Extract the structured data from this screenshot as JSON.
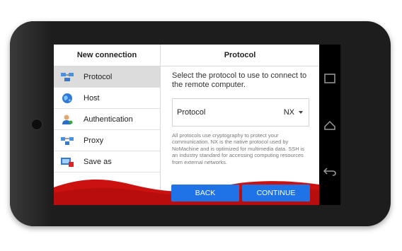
{
  "sidebar": {
    "title": "New connection",
    "items": [
      {
        "label": "Protocol",
        "icon": "network-icon",
        "active": true
      },
      {
        "label": "Host",
        "icon": "globe-icon",
        "active": false
      },
      {
        "label": "Authentication",
        "icon": "user-icon",
        "active": false
      },
      {
        "label": "Proxy",
        "icon": "proxy-icon",
        "active": false
      },
      {
        "label": "Save as",
        "icon": "save-icon",
        "active": false
      }
    ]
  },
  "main": {
    "title": "Protocol",
    "prompt": "Select the protocol to use to connect to the remote computer.",
    "protocol_label": "Protocol",
    "protocol_value": "NX",
    "description": "All protocols use cryptography to protect your communication. NX is the native protocol used by NoMachine and is optimized for multimedia data. SSH is an industry standard for accessing computing resources from external networks."
  },
  "buttons": {
    "back": "BACK",
    "continue": "CONTINUE"
  },
  "colors": {
    "accent": "#1f73e6",
    "wave": "#cc1111",
    "active_item": "#dcdcdc"
  },
  "android_nav": [
    "recents-icon",
    "home-icon",
    "back-icon"
  ]
}
